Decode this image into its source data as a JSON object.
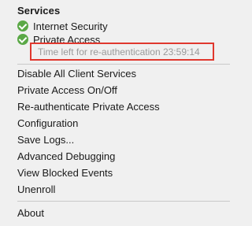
{
  "menu": {
    "section_header": "Services",
    "services": [
      {
        "label": "Internet Security",
        "icon": "check-circle-icon"
      },
      {
        "label": "Private Access",
        "icon": "check-circle-icon"
      }
    ],
    "notice": "Time left for re-authentication 23:59:14",
    "items": [
      {
        "label": "Disable All Client Services"
      },
      {
        "label": "Private Access On/Off"
      },
      {
        "label": "Re-authenticate Private Access"
      },
      {
        "label": "Configuration"
      },
      {
        "label": "Save Logs..."
      },
      {
        "label": "Advanced Debugging"
      },
      {
        "label": "View Blocked Events"
      },
      {
        "label": "Unenroll"
      }
    ],
    "footer_item": "About"
  },
  "colors": {
    "menu_background": "#f0f0f0",
    "check_icon": "#5aa846",
    "highlight_border": "#e0382e",
    "notice_text": "#9a9a9a",
    "separator": "#c9c9c9"
  }
}
